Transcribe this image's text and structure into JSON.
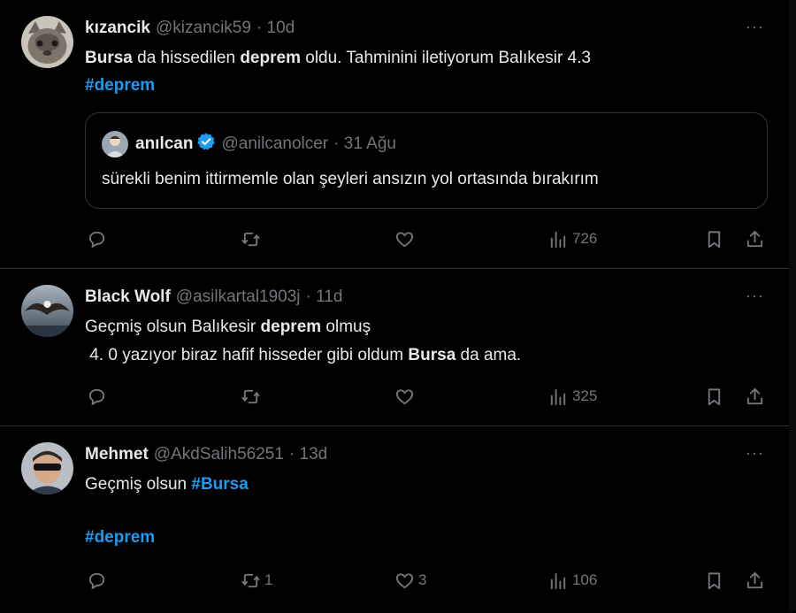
{
  "tweets": [
    {
      "name": "kızancik",
      "handle": "@kizancik59",
      "time": "· 10d",
      "text": {
        "b1": "Bursa",
        "s1": " da hissedilen ",
        "b2": "deprem",
        "s2": " oldu. Tahminini iletiyorum Balıkesir 4.3",
        "hashtag": "#deprem"
      },
      "quote": {
        "name": "anılcan",
        "handle": "@anilcanolcer",
        "time": "· 31 Ağu",
        "text": "sürekli benim ittirmemle olan şeyleri ansızın yol ortasında bırakırım"
      },
      "actions": {
        "replies": "",
        "reposts": "",
        "likes": "",
        "views": "726"
      }
    },
    {
      "name": "Black Wolf",
      "handle": "@asilkartal1903j",
      "time": "· 11d",
      "text": {
        "line1_a": "Geçmiş olsun Balıkesir ",
        "line1_b": "deprem",
        "line1_c": " olmuş",
        "line2_a": " 4. 0 yazıyor biraz hafif hisseder gibi oldum ",
        "line2_b": "Bursa",
        "line2_c": " da ama."
      },
      "actions": {
        "replies": "",
        "reposts": "",
        "likes": "",
        "views": "325"
      }
    },
    {
      "name": "Mehmet",
      "handle": "@AkdSalih56251",
      "time": "· 13d",
      "text": {
        "line1": "Geçmiş olsun ",
        "hashtag1": "#Bursa",
        "hashtag2": "#deprem"
      },
      "actions": {
        "replies": "",
        "reposts": "1",
        "likes": "3",
        "views": "106"
      }
    }
  ],
  "more_label": "···",
  "colors": {
    "accent": "#1d9bf0",
    "muted": "#71767b",
    "border": "#2f3336",
    "background": "#000000"
  },
  "icons": [
    "reply-icon",
    "repost-icon",
    "like-icon",
    "views-icon",
    "bookmark-icon",
    "share-icon",
    "more-icon",
    "verified-badge-icon"
  ]
}
